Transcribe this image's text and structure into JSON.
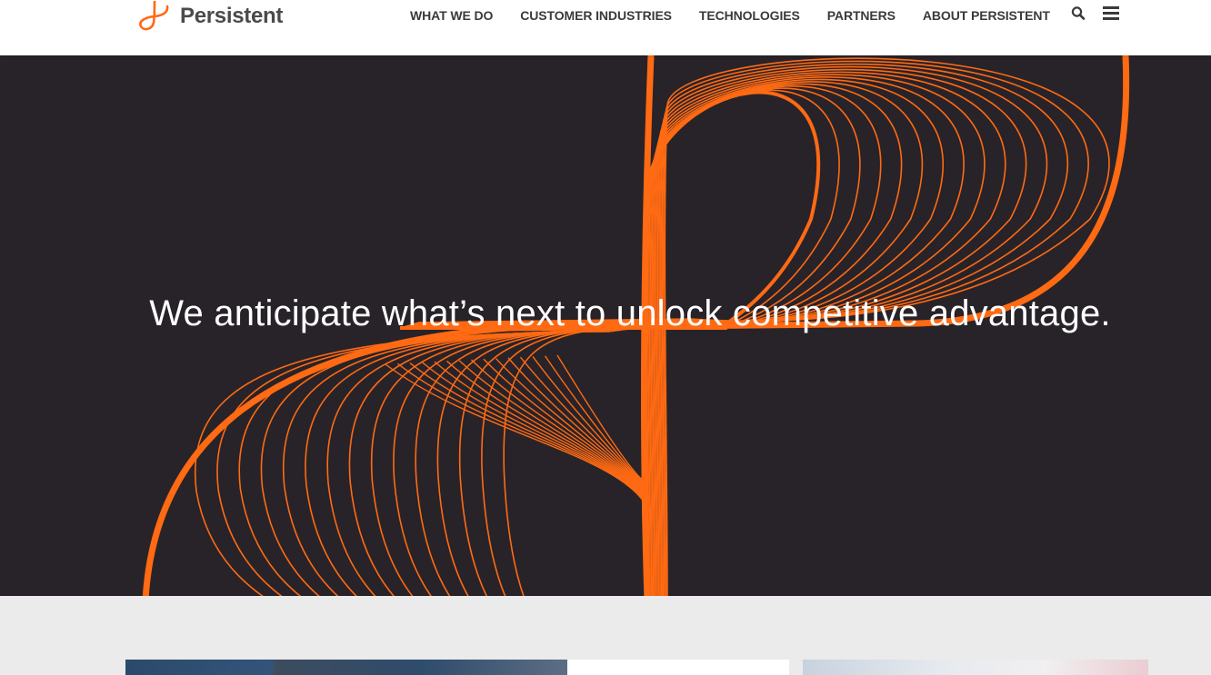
{
  "header": {
    "brand": "Persistent",
    "nav": [
      {
        "label": "WHAT WE DO"
      },
      {
        "label": "CUSTOMER INDUSTRIES"
      },
      {
        "label": "TECHNOLOGIES"
      },
      {
        "label": "PARTNERS"
      },
      {
        "label": "ABOUT PERSISTENT"
      }
    ],
    "icons": [
      "search-icon",
      "menu-icon"
    ]
  },
  "hero": {
    "headline": "We anticipate what’s next to unlock competitive advantage."
  },
  "colors": {
    "brand_orange": "#ff6a13",
    "hero_bg": "#282329",
    "nav_text": "#3a3a3a",
    "section_bg": "#ebebeb"
  }
}
